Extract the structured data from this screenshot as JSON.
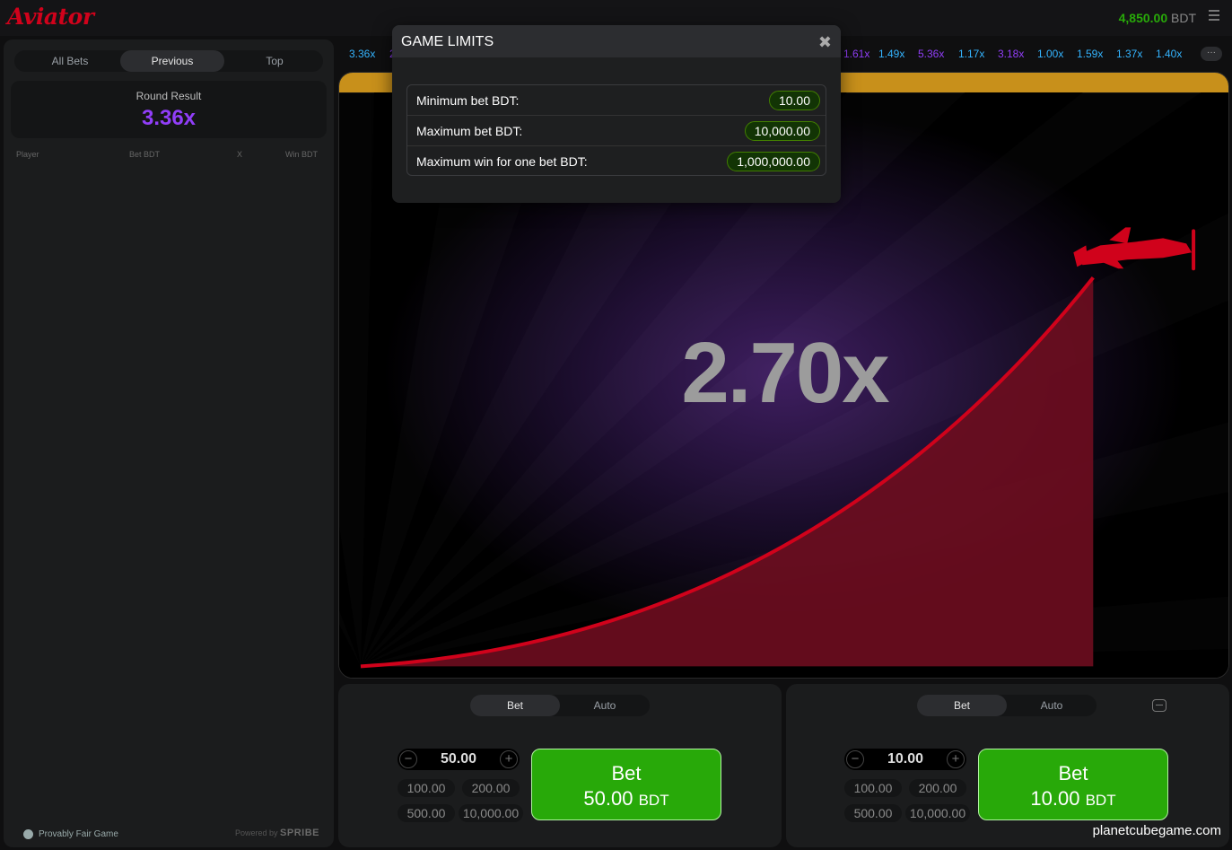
{
  "app": {
    "logo": "Aviator"
  },
  "header": {
    "balance_amount": "4,850.00",
    "balance_currency": "BDT"
  },
  "left_panel": {
    "tabs": [
      {
        "label": "All Bets",
        "active": false
      },
      {
        "label": "Previous",
        "active": true
      },
      {
        "label": "Top",
        "active": false
      }
    ],
    "round_result_label": "Round Result",
    "round_result_value": "3.36x",
    "columns": {
      "player": "Player",
      "bet": "Bet BDT",
      "x": "X",
      "win": "Win BDT"
    },
    "provably_fair": "Provably Fair Game",
    "powered_by": "Powered by",
    "powered_brand": "SPRIBE"
  },
  "history": {
    "items": [
      {
        "value": "3.36x",
        "color": "#34b4ff"
      },
      {
        "value": "2",
        "color": "#913ef8"
      },
      {
        "value": "1.61x",
        "color": "#913ef8"
      },
      {
        "value": "1.49x",
        "color": "#34b4ff"
      },
      {
        "value": "5.36x",
        "color": "#913ef8"
      },
      {
        "value": "1.17x",
        "color": "#34b4ff"
      },
      {
        "value": "3.18x",
        "color": "#913ef8"
      },
      {
        "value": "1.00x",
        "color": "#34b4ff"
      },
      {
        "value": "1.59x",
        "color": "#34b4ff"
      },
      {
        "value": "1.37x",
        "color": "#34b4ff"
      },
      {
        "value": "1.40x",
        "color": "#34b4ff"
      }
    ],
    "more": "···"
  },
  "game": {
    "multiplier": "2.70x",
    "accent": "#d0021b"
  },
  "bet_panels": [
    {
      "tabs": [
        "Bet",
        "Auto"
      ],
      "amount": "50.00",
      "quick": [
        "100.00",
        "200.00",
        "500.00",
        "10,000.00"
      ],
      "button_label": "Bet",
      "button_amount": "50.00",
      "button_currency": "BDT"
    },
    {
      "tabs": [
        "Bet",
        "Auto"
      ],
      "amount": "10.00",
      "quick": [
        "100.00",
        "200.00",
        "500.00",
        "10,000.00"
      ],
      "button_label": "Bet",
      "button_amount": "10.00",
      "button_currency": "BDT"
    }
  ],
  "modal": {
    "title": "GAME LIMITS",
    "close_glyph": "✖",
    "rows": [
      {
        "label": "Minimum bet BDT:",
        "value": "10.00"
      },
      {
        "label": "Maximum bet BDT:",
        "value": "10,000.00"
      },
      {
        "label": "Maximum win for one bet BDT:",
        "value": "1,000,000.00"
      }
    ]
  },
  "watermark": "planetcubegame.com"
}
